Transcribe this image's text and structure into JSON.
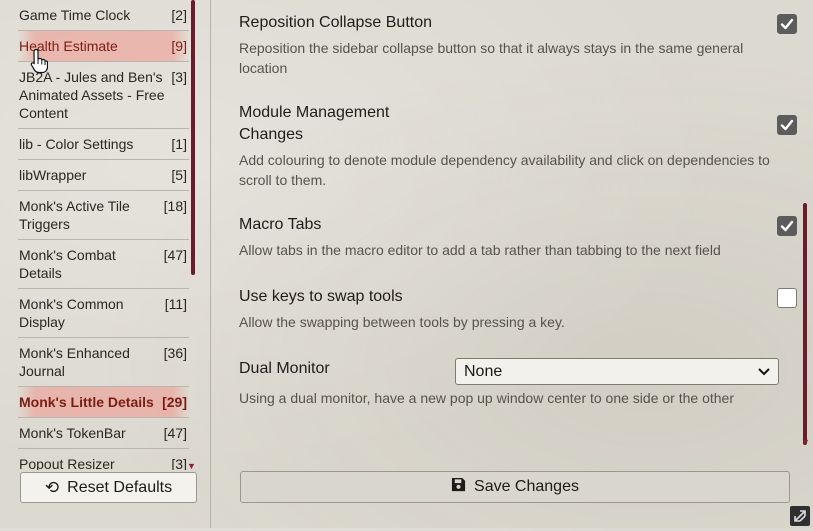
{
  "sidebar": {
    "items": [
      {
        "label": "Game Time Clock",
        "count": "[2]",
        "style": ""
      },
      {
        "label": "Health Estimate",
        "count": "[9]",
        "style": "highlight"
      },
      {
        "label": "JB2A - Jules and Ben's Animated Assets - Free Content",
        "count": "[3]",
        "style": ""
      },
      {
        "label": "lib - Color Settings",
        "count": "[1]",
        "style": ""
      },
      {
        "label": "libWrapper",
        "count": "[5]",
        "style": ""
      },
      {
        "label": "Monk's Active Tile Triggers",
        "count": "[18]",
        "style": ""
      },
      {
        "label": "Monk's Combat Details",
        "count": "[47]",
        "style": ""
      },
      {
        "label": "Monk's Common Display",
        "count": "[11]",
        "style": ""
      },
      {
        "label": "Monk's Enhanced Journal",
        "count": "[36]",
        "style": ""
      },
      {
        "label": "Monk's Little Details",
        "count": "[29]",
        "style": "highlight bold"
      },
      {
        "label": "Monk's TokenBar",
        "count": "[47]",
        "style": ""
      },
      {
        "label": "Popout Resizer",
        "count": "[3]",
        "style": ""
      }
    ],
    "reset_label": "Reset Defaults",
    "reset_icon": "undo-icon"
  },
  "settings": [
    {
      "title": "Reposition Collapse Button",
      "hint": "Reposition the sidebar collapse button so that it always stays in the same general location",
      "checked": true
    },
    {
      "title": "Module Management Changes",
      "hint": "Add colouring to denote module dependency availability and click on dependencies to scroll to them.",
      "checked": true
    },
    {
      "title": "Macro Tabs",
      "hint": "Allow tabs in the macro editor to add a tab rather than tabbing to the next field",
      "checked": true
    },
    {
      "title": "Use keys to swap tools",
      "hint": "Allow the swapping between tools by pressing a key.",
      "checked": false
    }
  ],
  "dual_monitor": {
    "title": "Dual Monitor",
    "selected": "None",
    "hint": "Using a dual monitor, have a new pop up window center to one side or the other"
  },
  "save_label": "Save Changes",
  "save_icon": "save-icon",
  "colors": {
    "accent": "#6b1c2a",
    "highlight": "#f0968c"
  }
}
